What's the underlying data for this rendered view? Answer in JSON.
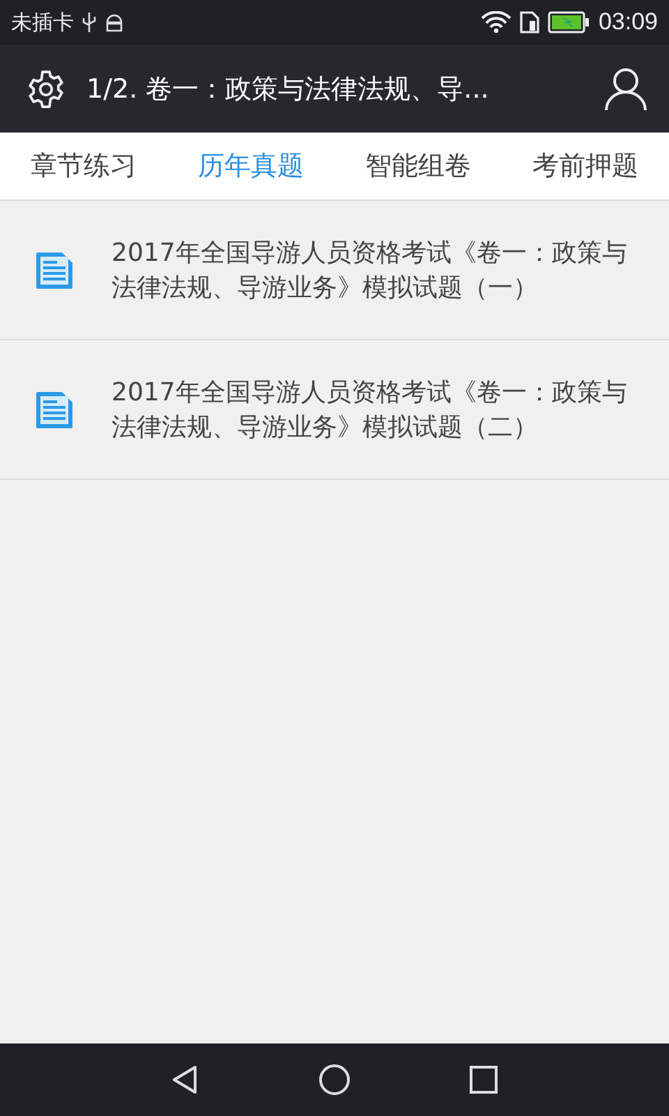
{
  "status_bar": {
    "carrier": "未插卡",
    "time": "03:09"
  },
  "header": {
    "title": "1/2. 卷一：政策与法律法规、导..."
  },
  "tabs": [
    {
      "label": "章节练习",
      "selected": false
    },
    {
      "label": "历年真题",
      "selected": true
    },
    {
      "label": "智能组卷",
      "selected": false
    },
    {
      "label": "考前押题",
      "selected": false
    }
  ],
  "items": [
    {
      "title": "2017年全国导游人员资格考试《卷一：政策与法律法规、导游业务》模拟试题（一）"
    },
    {
      "title": "2017年全国导游人员资格考试《卷一：政策与法律法规、导游业务》模拟试题（二）"
    }
  ]
}
